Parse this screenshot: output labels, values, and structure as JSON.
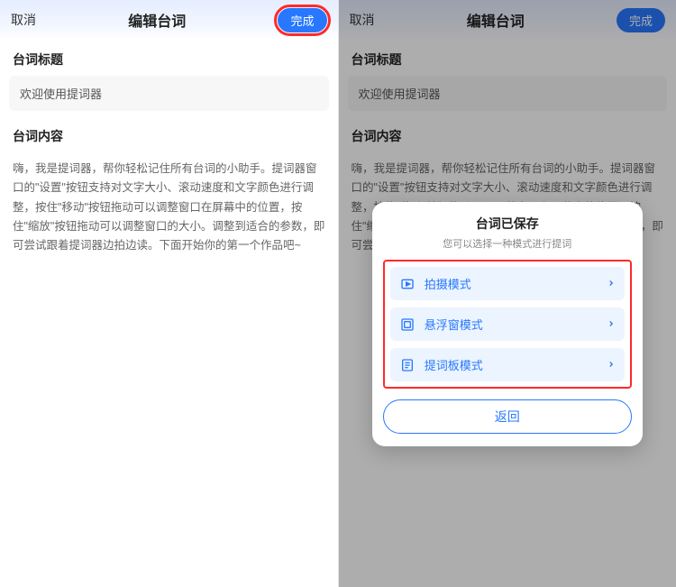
{
  "header": {
    "cancel": "取消",
    "title": "编辑台词",
    "done": "完成"
  },
  "form": {
    "title_label": "台词标题",
    "title_value": "欢迎使用提词器",
    "content_label": "台词内容",
    "content_value": "嗨，我是提词器，帮你轻松记住所有台词的小助手。提词器窗口的\"设置\"按钮支持对文字大小、滚动速度和文字颜色进行调整，按住\"移动\"按钮拖动可以调整窗口在屏幕中的位置，按住\"缩放\"按钮拖动可以调整窗口的大小。调整到适合的参数，即可尝试跟着提词器边拍边读。下面开始你的第一个作品吧~"
  },
  "modal": {
    "title": "台词已保存",
    "subtitle": "您可以选择一种模式进行提词",
    "modes": [
      {
        "label": "拍摄模式"
      },
      {
        "label": "悬浮窗模式"
      },
      {
        "label": "提词板模式"
      }
    ],
    "back": "返回"
  }
}
